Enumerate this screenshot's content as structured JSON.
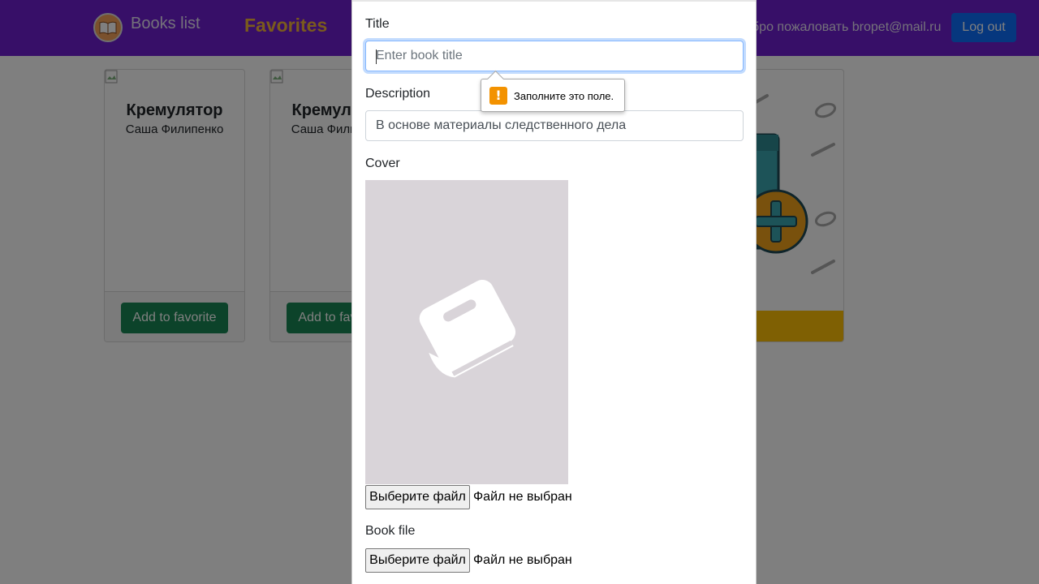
{
  "nav": {
    "brand": "Books list",
    "favorites": "Favorites",
    "welcome": "бро пожаловать bropet@mail.ru",
    "logout": "Log out",
    "colors": {
      "navbar": "#6f1fd0",
      "favorites": "#f5b53a",
      "logout": "#0d6efd"
    }
  },
  "cards": [
    {
      "title": "Кремулятор",
      "author": "Саша Филипенко",
      "button": "Add to favorite"
    },
    {
      "title": "Кремулятор",
      "author": "Саша Филипенко",
      "button": "Add to favorite"
    }
  ],
  "modal": {
    "title_label": "Title",
    "title_placeholder": "Enter book title",
    "title_value": "",
    "description_label": "Description",
    "description_value": "В основе материалы следственного дела",
    "cover_label": "Cover",
    "cover_icon": "book-icon",
    "cover_file_button": "Выберите файл",
    "cover_file_status": "Файл не выбран",
    "book_file_label": "Book file",
    "book_file_button": "Выберите файл",
    "book_file_status": "Файл не выбран"
  },
  "validation_tooltip": {
    "message": "Заполните это поле.",
    "icon": "warning-icon",
    "color": "#f39200"
  }
}
